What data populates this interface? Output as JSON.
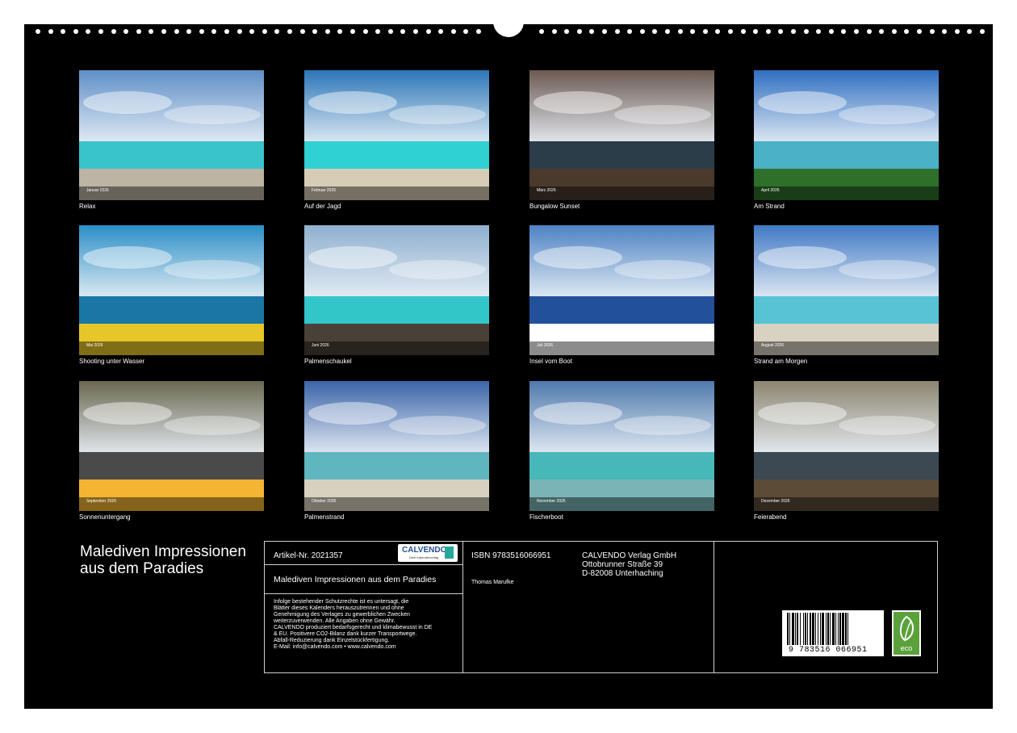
{
  "months": [
    {
      "month_label": "Januar 2026",
      "caption": "Relax",
      "sky": "#5f8fc8",
      "sea": "#39c3cb",
      "ground": "#bdb4a4"
    },
    {
      "month_label": "Februar 2026",
      "caption": "Auf der Jagd",
      "sky": "#2b76b8",
      "sea": "#2fd1d3",
      "ground": "#d7cdb7"
    },
    {
      "month_label": "März 2026",
      "caption": "Bungalow Sunset",
      "sky": "#6c5a52",
      "sea": "#2c3d4a",
      "ground": "#4a3a2c"
    },
    {
      "month_label": "April 2026",
      "caption": "Am Strand",
      "sky": "#2f6fc1",
      "sea": "#4bb1c6",
      "ground": "#2e6f2a"
    },
    {
      "month_label": "Mai 2026",
      "caption": "Shooting unter Wasser",
      "sky": "#2b8fc7",
      "sea": "#1a77a5",
      "ground": "#e7c62a"
    },
    {
      "month_label": "Juni 2026",
      "caption": "Palmenschaukel",
      "sky": "#8fb0d0",
      "sea": "#32c6c9",
      "ground": "#494037"
    },
    {
      "month_label": "Juli 2026",
      "caption": "Insel vom Boot",
      "sky": "#4d83c4",
      "sea": "#23509a",
      "ground": "#ffffff"
    },
    {
      "month_label": "August 2026",
      "caption": "Strand am Morgen",
      "sky": "#3f79c4",
      "sea": "#57c3d5",
      "ground": "#d9d2c2"
    },
    {
      "month_label": "September 2026",
      "caption": "Sonnenuntergang",
      "sky": "#6a6750",
      "sea": "#4a4a4a",
      "ground": "#f3b532"
    },
    {
      "month_label": "Oktober 2026",
      "caption": "Palmenstrand",
      "sky": "#3b64a9",
      "sea": "#5fb6bf",
      "ground": "#d8d1c0"
    },
    {
      "month_label": "November 2026",
      "caption": "Fischerboot",
      "sky": "#4f79ad",
      "sea": "#47b7b9",
      "ground": "#7ab4b7"
    },
    {
      "month_label": "Dezember 2026",
      "caption": "Feierabend",
      "sky": "#8c8570",
      "sea": "#3c4952",
      "ground": "#5b4b37"
    }
  ],
  "title": "Malediven Impressionen aus dem Paradies",
  "imprint": {
    "article_no": "Artikel-Nr. 2021357",
    "logo_text": "CALVENDO",
    "logo_sub": "Dein Kalenderverlag",
    "subtitle": "Malediven Impressionen aus dem Paradies",
    "disclaimer_lines": [
      "Infolge bestehender Schutzrechte ist es untersagt, die",
      "Blätter dieses Kalenders herauszutrennen und ohne",
      "Genehmigung des Verlages zu gewerblichen Zwecken",
      "weiterzuverwenden. Alle Angaben ohne Gewähr.",
      "CALVENDO produziert bedarfsgerecht und klimabewusst in DE",
      "& EU. Positivere CO2-Bilanz dank kurzer Transportwege.",
      "Abfall-Reduzierung dank Einzelstückfertigung.",
      "E-Mail: info@calvendo.com • www.calvendo.com"
    ],
    "isbn": "ISBN 9783516066951",
    "author": "Thomas Marufke",
    "publisher_lines": [
      "CALVENDO Verlag GmbH",
      "Ottobrunner Straße 39",
      "D-82008 Unterhaching"
    ],
    "barcode_number": "9 783516 066951",
    "eco_label": "eco"
  }
}
